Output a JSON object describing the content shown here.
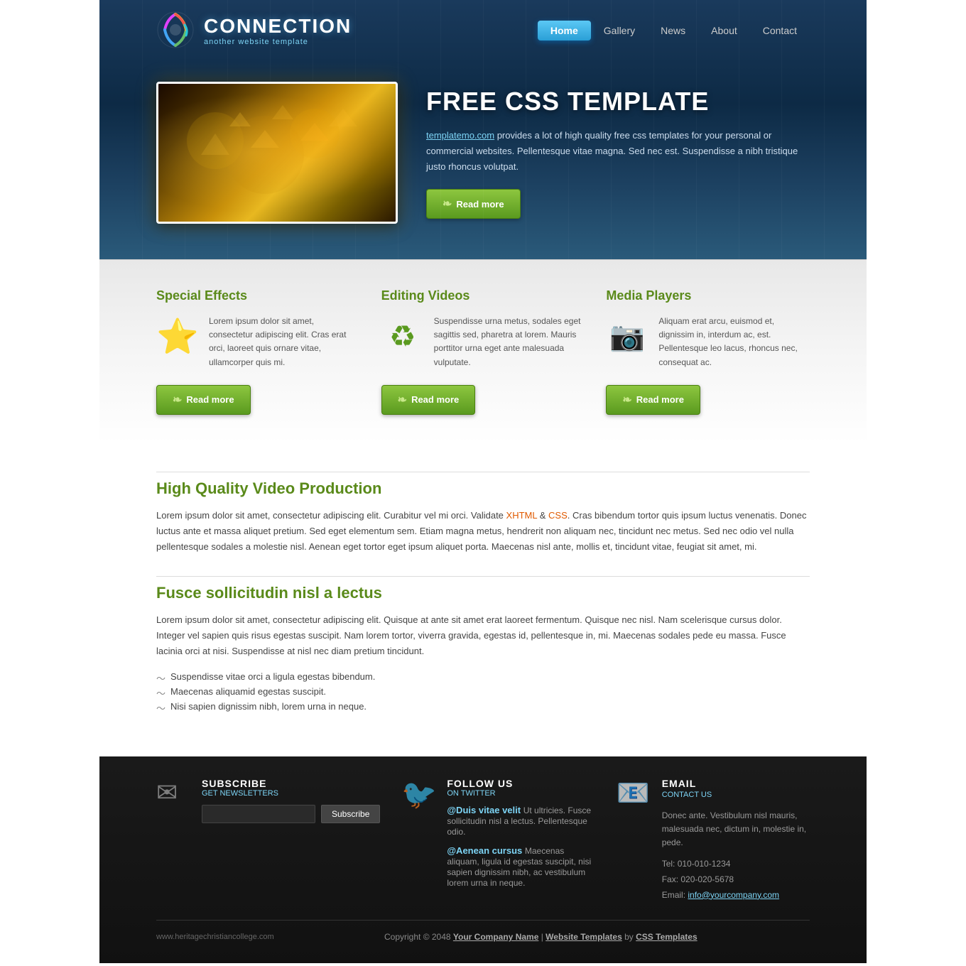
{
  "site": {
    "title": "CONNECTION",
    "tagline": "another website template",
    "url": "www.heritagechristiancollege.com"
  },
  "nav": {
    "items": [
      {
        "label": "Home",
        "active": true
      },
      {
        "label": "Gallery",
        "active": false
      },
      {
        "label": "News",
        "active": false
      },
      {
        "label": "About",
        "active": false
      },
      {
        "label": "Contact",
        "active": false
      }
    ]
  },
  "hero": {
    "title": "FREE CSS TEMPLATE",
    "link_text": "templatemo.com",
    "description": " provides a lot of high quality free css templates for your personal or commercial websites. Pellentesque vitae magna. Sed nec est. Suspendisse a nibh tristique justo rhoncus volutpat.",
    "btn_label": "Read more"
  },
  "features": {
    "items": [
      {
        "title": "Special Effects",
        "icon": "⭐",
        "text": "Lorem ipsum dolor sit amet, consectetur adipiscing elit. Cras erat orci, laoreet quis ornare vitae, ullamcorper quis mi.",
        "btn": "Read more"
      },
      {
        "title": "Editing Videos",
        "icon": "♻",
        "text": "Suspendisse urna metus, sodales eget sagittis sed, pharetra at lorem. Mauris porttitor urna eget ante malesuada vulputate.",
        "btn": "Read more"
      },
      {
        "title": "Media Players",
        "icon": "📷",
        "text": "Aliquam erat arcu, euismod et, dignissim in, interdum ac, est. Pellentesque leo lacus, rhoncus nec, consequat ac.",
        "btn": "Read more"
      }
    ]
  },
  "sections": [
    {
      "title": "High Quality Video Production",
      "text": "Lorem ipsum dolor sit amet, consectetur adipiscing elit. Curabitur vel mi orci. Validate ",
      "link1_text": "XHTML",
      "link2_text": "CSS",
      "text2": ". Cras bibendum tortor quis ipsum luctus venenatis. Donec luctus ante et massa aliquet pretium. Sed eget elementum sem. Etiam magna metus, hendrerit non aliquam nec, tincidunt nec metus. Sed nec odio vel nulla pellentesque sodales a molestie nisl. Aenean eget tortor eget ipsum aliquet porta. Maecenas nisl ante, mollis et, tincidunt vitae, feugiat sit amet, mi.",
      "list": []
    },
    {
      "title": "Fusce sollicitudin nisl a lectus",
      "text": "Lorem ipsum dolor sit amet, consectetur adipiscing elit. Quisque at ante sit amet erat laoreet fermentum. Quisque nec nisl. Nam scelerisque cursus dolor. Integer vel sapien quis risus egestas suscipit. Nam lorem tortor, viverra gravida, egestas id, pellentesque in, mi. Maecenas sodales pede eu massa. Fusce lacinia orci at nisi. Suspendisse at nisl nec diam pretium tincidunt.",
      "list": [
        "Suspendisse vitae orci a ligula egestas bibendum.",
        "Maecenas aliquamid egestas suscipit.",
        "Nisi sapien dignissim nibh, lorem urna in neque."
      ]
    }
  ],
  "footer": {
    "subscribe": {
      "title": "SUBSCRIBE",
      "subtitle": "GET NEWSLETTERS",
      "placeholder": "",
      "btn_label": "Subscribe"
    },
    "twitter": {
      "title": "FOLLOW US",
      "subtitle": "ON TWITTER",
      "posts": [
        {
          "handle": "@Duis vitae velit",
          "text": " Ut ultricies. Fusce sollicitudin nisl a lectus. Pellentesque odio."
        },
        {
          "handle": "@Aenean cursus",
          "text": " Maecenas aliquam, ligula id egestas suscipit, nisi sapien dignissim nibh, ac vestibulum lorem urna in neque."
        }
      ]
    },
    "email": {
      "title": "EMAIL",
      "subtitle": "CONTACT US",
      "description": "Donec ante. Vestibulum nisl mauris, malesuada nec, dictum in, molestie in, pede.",
      "tel": "Tel: 010-010-1234",
      "fax": "Fax: 020-020-5678",
      "email_label": "Email:",
      "email_link": "info@yourcompany.com"
    },
    "copyright": "Copyright © 2048",
    "company": "Your Company Name",
    "website_templates": "Website Templates",
    "by": "by",
    "css_templates": "CSS Templates"
  }
}
